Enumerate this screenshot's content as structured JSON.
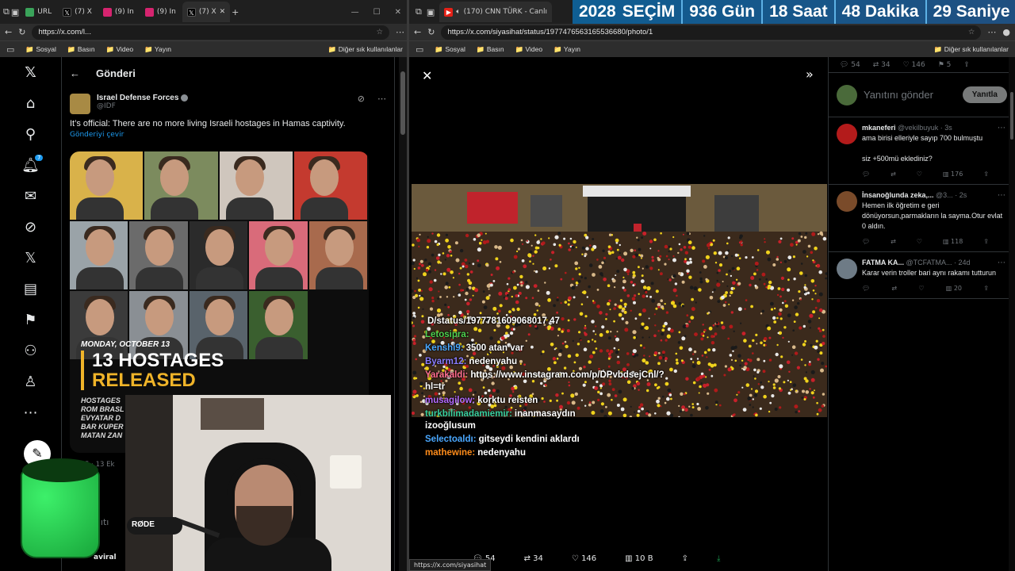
{
  "left": {
    "tabs": [
      {
        "label": "URL",
        "fav": "#3aa35a"
      },
      {
        "label": "(7) X",
        "fav": "#000"
      },
      {
        "label": "(9) In",
        "fav": "#d6246f"
      },
      {
        "label": "(9) In",
        "fav": "#d6246f"
      },
      {
        "label": "(7) X",
        "fav": "#000"
      }
    ],
    "url": "https://x.com/l...",
    "bookmarks": [
      "Sosyal",
      "Basın",
      "Video",
      "Yayın"
    ],
    "other_bookmarks": "Diğer sık kullanılanlar",
    "header": "Gönderi",
    "author": {
      "name": "Israel Defense Forces",
      "handle": "@IDF"
    },
    "post_text": "It’s official: There are no more living Israeli hostages in Hamas captivity.",
    "translate": "Gönderiyi çevir",
    "image": {
      "date": "MONDAY, OCTOBER 13",
      "line1": "13 HOSTAGES",
      "line2": "RELEASED",
      "names_title": "HOSTAGES",
      "names": [
        "ROM BRASL",
        "EVYATAR D",
        "BAR KUPER",
        "MATAN ZAN"
      ]
    },
    "footer": "11:55 · 13 Ek",
    "reply_hint": "Yanıtı",
    "bottom_name": "aviral",
    "notif_count": "7",
    "mic_label": "RØDE",
    "status_url": "https://x.com/siyasihat"
  },
  "right": {
    "tabs": [
      {
        "label": "(170) CNN TÜRK - Canlı",
        "fav": "#e62117"
      }
    ],
    "countdown": {
      "year": "2028",
      "title": "SEÇİM",
      "days": "936 Gün",
      "hours": "18 Saat",
      "minutes": "48 Dakika",
      "seconds": "29 Saniye"
    },
    "url": "https://x.com/siyasihat/status/1977476563165536680/photo/1",
    "bookmarks": [
      "Sosyal",
      "Basın",
      "Video",
      "Yayın"
    ],
    "other_bookmarks": "Diğer sık kullanılanlar",
    "media_actions": {
      "replies": "54",
      "reposts": "34",
      "likes": "146",
      "views": "10 B"
    },
    "top_stats": {
      "replies": "54",
      "reposts": "34",
      "likes": "146",
      "bookmarks": "5"
    },
    "reply_placeholder": "Yanıtını gönder",
    "reply_button": "Yanıtla",
    "replies": [
      {
        "name": "mkaneferi",
        "handle": "@vekilbuyuk · 3s",
        "text": "ama birisi elleriyle sayıp 700 bulmuştu\n\nsiz +500mü eklediniz?",
        "views": "176",
        "av": "#b31b1b"
      },
      {
        "name": "İnsanoğlunda zeka,...",
        "handle": "@3... · 2s",
        "text": "Hemen ilk öğretim e geri dönüyorsun,parmakların la sayma.Otur evlat 0 aldın.",
        "views": "118",
        "av": "#7a4b2a"
      },
      {
        "name": "FATMA KA...",
        "handle": "@TCFATMA... · 24d",
        "text": "Karar verin troller bari aynı rakamı tutturun",
        "views": "20",
        "av": "#6e7b86"
      }
    ],
    "chat": [
      {
        "user": "",
        "msg": "D/status/1977781609068017 47",
        "color": "#fff"
      },
      {
        "user": "Letosipra:",
        "msg": "",
        "color": "#4fd14f"
      },
      {
        "user": "Kenshi9:",
        "msg": "3500 atan var",
        "color": "#4aa8ff"
      },
      {
        "user": "Byarm12:",
        "msg": "nedenyahu",
        "color": "#8a7dff"
      },
      {
        "user": "Yarakaldi:",
        "msg": "https://www.instagram.com/p/DPvbdsejCnl/?hl=tr",
        "color": "#ff6f91"
      },
      {
        "user": "musagilow:",
        "msg": "korktu reisten",
        "color": "#b46bff"
      },
      {
        "user": "turkbilimadamiemir:",
        "msg": "inanmasaydın izooğlusum",
        "color": "#3ad0a0"
      },
      {
        "user": "Selectoaldı:",
        "msg": "gitseydi kendini aklardı",
        "color": "#4aa8ff"
      },
      {
        "user": "mathewine:",
        "msg": "nedenyahu",
        "color": "#ff8c1a"
      }
    ]
  }
}
